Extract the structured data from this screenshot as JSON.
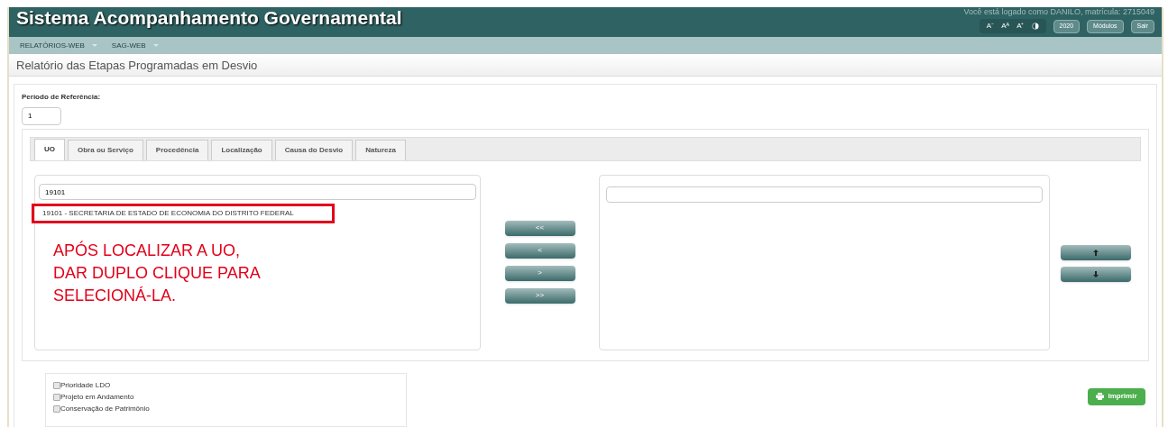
{
  "header": {
    "title": "Sistema Acompanhamento Governamental",
    "user_info": "Você está logado como DANILO, matrícula: 2715049",
    "accessibility": [
      "A⁻",
      "Aᴬ",
      "A⁺"
    ],
    "buttons": [
      "2020",
      "Módulos",
      "Sair"
    ]
  },
  "nav": {
    "items": [
      "RELATÓRIOS-WEB",
      "SAG-WEB"
    ]
  },
  "page_title": "Relatório das Etapas Programadas em Desvio",
  "period": {
    "label": "Período de Referência:",
    "value": "1"
  },
  "tabs": [
    {
      "label": "UO",
      "selected": true
    },
    {
      "label": "Obra ou Serviço",
      "selected": false
    },
    {
      "label": "Procedência",
      "selected": false
    },
    {
      "label": "Localização",
      "selected": false
    },
    {
      "label": "Causa do Desvio",
      "selected": false
    },
    {
      "label": "Natureza",
      "selected": false
    }
  ],
  "left_list": {
    "search": "19101",
    "items": [
      {
        "label": "19101 - SECRETARIA DE ESTADO DE ECONOMIA DO DISTRITO FEDERAL",
        "highlighted": true
      }
    ]
  },
  "annotation": [
    "APÓS LOCALIZAR A UO,",
    "DAR DUPLO CLIQUE PARA",
    "SELECIONÁ-LA."
  ],
  "transfer_buttons": [
    "<<",
    "<",
    ">",
    ">>"
  ],
  "right_list": {
    "has_search": true
  },
  "checkboxes": [
    {
      "label": "Prioridade LDO",
      "checked": false
    },
    {
      "label": "Projeto em Andamento",
      "checked": false
    },
    {
      "label": "Conservação de Patrimônio",
      "checked": false
    }
  ],
  "print_button": "Imprimir"
}
